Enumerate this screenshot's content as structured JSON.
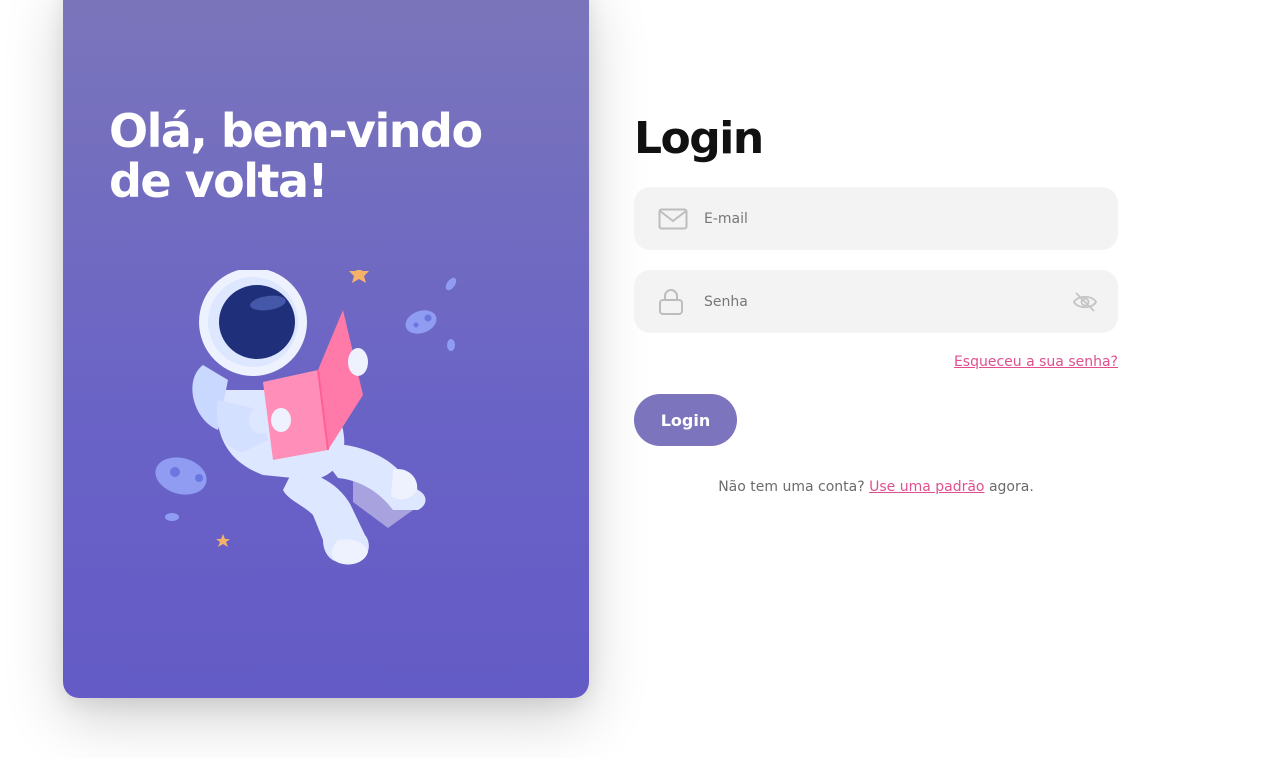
{
  "hero": {
    "title": "Olá, bem-vindo de volta!",
    "illustration": "astronaut-reading-illustration"
  },
  "login": {
    "title": "Login",
    "email": {
      "placeholder": "E-mail",
      "value": "",
      "icon": "mail-icon"
    },
    "password": {
      "placeholder": "Senha",
      "value": "",
      "icon": "lock-icon",
      "toggle_icon": "eye-off-icon"
    },
    "forgot_label": "Esqueceu a sua senha?",
    "submit_label": "Login",
    "signup_prefix": "Não tem uma conta?",
    "signup_link": "Use uma padrão",
    "signup_suffix": "agora."
  },
  "colors": {
    "hero_gradient_top": "#7b76ba",
    "hero_gradient_bottom": "#645bc6",
    "accent_pink": "#e0508f",
    "button": "#7c74bd",
    "field_bg": "#f3f3f3"
  }
}
